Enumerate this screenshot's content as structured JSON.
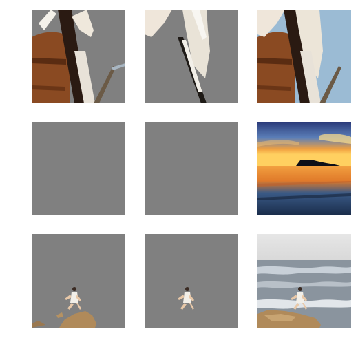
{
  "figure": {
    "rows": [
      {
        "name": "row-cello",
        "panels": [
          {
            "kind": "masked-foreground",
            "icon": "cello-mask-a"
          },
          {
            "kind": "masked-foreground",
            "icon": "cello-mask-b"
          },
          {
            "kind": "original-image",
            "icon": "cello-photo"
          }
        ]
      },
      {
        "name": "row-sunset",
        "panels": [
          {
            "kind": "empty-mask",
            "icon": "empty-mask"
          },
          {
            "kind": "empty-mask",
            "icon": "empty-mask"
          },
          {
            "kind": "original-image",
            "icon": "sunset-beach-photo"
          }
        ]
      },
      {
        "name": "row-jumper",
        "panels": [
          {
            "kind": "masked-foreground",
            "icon": "jumper-mask-a"
          },
          {
            "kind": "masked-foreground",
            "icon": "jumper-mask-b"
          },
          {
            "kind": "original-image",
            "icon": "jumper-beach-photo"
          }
        ]
      }
    ],
    "colors": {
      "mask_gray": "#808080",
      "background": "#ffffff"
    }
  }
}
